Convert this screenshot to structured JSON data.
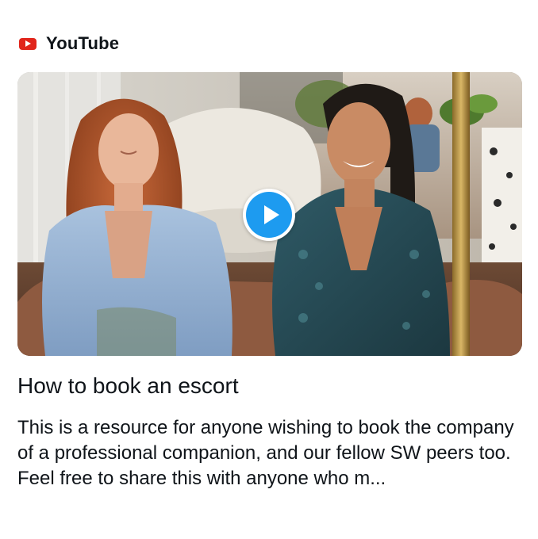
{
  "source": {
    "name": "YouTube",
    "icon": "youtube-logo-icon",
    "brand_color": "#e1251b"
  },
  "video": {
    "thumbnail_alt": "Two women sitting on a sofa in a living room",
    "play_icon": "play-icon",
    "accent_color": "#1d9bf0"
  },
  "card": {
    "title": "How to book an escort",
    "description": "This is a resource for anyone wishing to book the company of a professional companion, and our fellow SW peers too. Feel free to share this with anyone who m..."
  }
}
